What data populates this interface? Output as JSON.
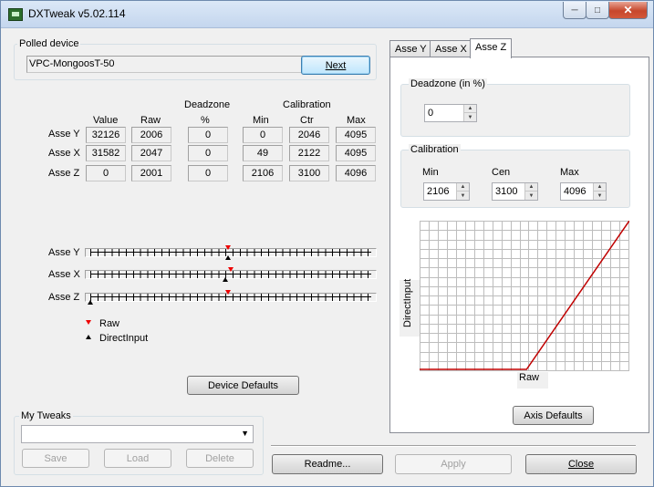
{
  "window": {
    "title": "DXTweak v5.02.114"
  },
  "polled": {
    "label": "Polled device",
    "device": "VPC-MongoosT-50",
    "next_btn": "Next"
  },
  "table": {
    "h_deadzone": "Deadzone",
    "h_calibration": "Calibration",
    "cols": [
      "Value",
      "Raw",
      "%",
      "Min",
      "Ctr",
      "Max"
    ],
    "rows": [
      {
        "axis": "Asse Y",
        "value": "32126",
        "raw": "2006",
        "pct": "0",
        "min": "0",
        "ctr": "2046",
        "max": "4095"
      },
      {
        "axis": "Asse X",
        "value": "31582",
        "raw": "2047",
        "pct": "0",
        "min": "49",
        "ctr": "2122",
        "max": "4095"
      },
      {
        "axis": "Asse Z",
        "value": "0",
        "raw": "2001",
        "pct": "0",
        "min": "2106",
        "ctr": "3100",
        "max": "4096"
      }
    ]
  },
  "sliders": [
    {
      "axis": "Asse Y",
      "raw_frac": 0.49,
      "di_frac": 0.49
    },
    {
      "axis": "Asse X",
      "raw_frac": 0.5,
      "di_frac": 0.48
    },
    {
      "axis": "Asse Z",
      "raw_frac": 0.49,
      "di_frac": 0.0
    }
  ],
  "legend": {
    "raw": "Raw",
    "di": "DirectInput"
  },
  "device_defaults_btn": "Device Defaults",
  "tweaks": {
    "label": "My Tweaks",
    "selected": "",
    "save": "Save",
    "load": "Load",
    "delete": "Delete"
  },
  "tabs": [
    "Asse Y",
    "Asse X",
    "Asse Z"
  ],
  "active_tab": "Asse Z",
  "panel": {
    "deadzone_label": "Deadzone (in %)",
    "deadzone_value": "0",
    "calibration_label": "Calibration",
    "min_label": "Min",
    "cen_label": "Cen",
    "max_label": "Max",
    "min_value": "2106",
    "cen_value": "3100",
    "max_value": "4096",
    "graph_ylabel": "DirectInput",
    "graph_xlabel": "Raw",
    "axis_defaults_btn": "Axis Defaults"
  },
  "curve": {
    "flat_until_frac": 0.51,
    "line_color": "#c00000"
  },
  "bottom": {
    "readme": "Readme...",
    "apply": "Apply",
    "close": "Close"
  }
}
